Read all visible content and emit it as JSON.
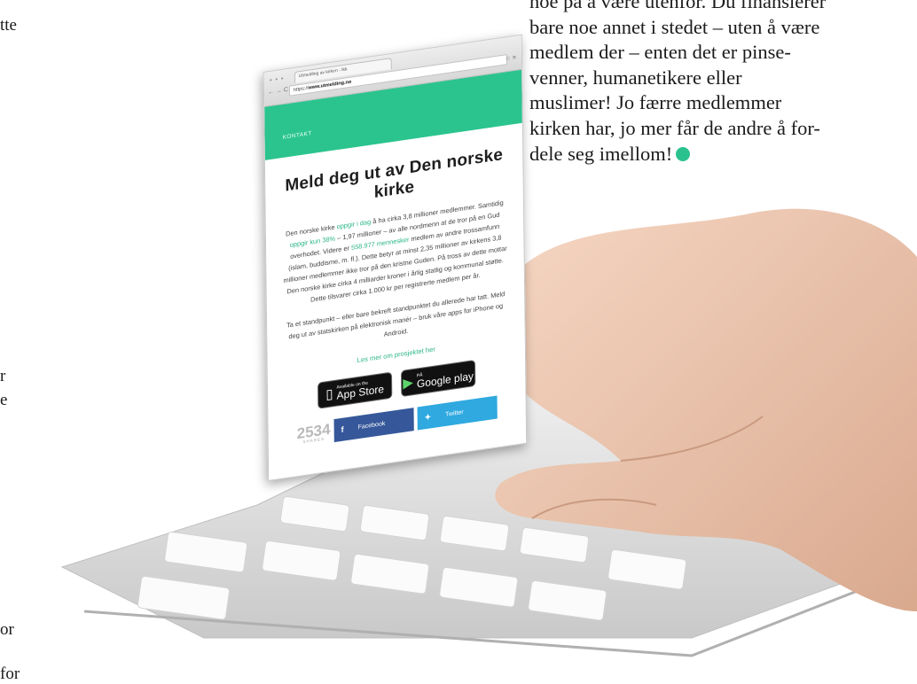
{
  "page_fragments": {
    "left_top": "tte",
    "left_mid1": "r",
    "left_mid2": "e",
    "left_bot1": "or",
    "left_bot2": "for"
  },
  "article": {
    "lines": [
      "noe på å være utenfor. Du finansierer",
      "bare noe annet i stedet – uten å være",
      "medlem der – enten det er pinse-",
      "venner, humanetikere eller",
      "muslimer! Jo færre medlemmer",
      "kirken har, jo mer får de andre å for-",
      "dele seg imellom!"
    ],
    "end_dot_color": "#2bc18f"
  },
  "browser": {
    "tab_title": "Utmelding av kirken - Ikk",
    "window_controls": "● ● ●",
    "nav_icons": "← → C",
    "url_prefix": "https://",
    "url_host": "www.utmelding.no",
    "tool_icons": "☆ ≡",
    "header_nav": "KONTAKT",
    "accent_color": "#2bc48e"
  },
  "site": {
    "title": "Meld deg ut av Den norske kirke",
    "para1_parts": [
      "Den norske kirke ",
      "oppgir i dag",
      " å ha cirka 3,8 millioner medlemmer. Samtidig ",
      "oppgir kun 38%",
      " – 1,97 millioner – av alle nordmenn at de tror på en Gud overhodet. Videre er ",
      "558.977 mennesker",
      " medlem av andre trossamfunn (islam, buddisme, m. fl.). Dette betyr at minst 2,35 millioner av kirkens 3,8 millioner medlemmer ikke tror på den kristne Guden. På tross av dette mottar Den norske kirke cirka 4 milliarder kroner i årlig statlig og kommunal støtte. Dette tilsvarer cirka 1.000 kr per registrerte medlem per år."
    ],
    "para2": "Ta et standpunkt – eller bare bekreft standpunktet du allerede har tatt. Meld deg ut av statskirken på elektronisk manér – bruk våre apps for iPhone og Android.",
    "more_link": "Les mer om prosjektet her",
    "appstore_small": "Available on the",
    "appstore_big": "App Store",
    "googleplay_small": "PÅ",
    "googleplay_big": "Google play",
    "share_count": "2534",
    "share_label": "SHARES",
    "facebook_label": "Facebook",
    "twitter_label": "Twitter",
    "facebook_color": "#36589a",
    "twitter_color": "#2fa9e0"
  }
}
